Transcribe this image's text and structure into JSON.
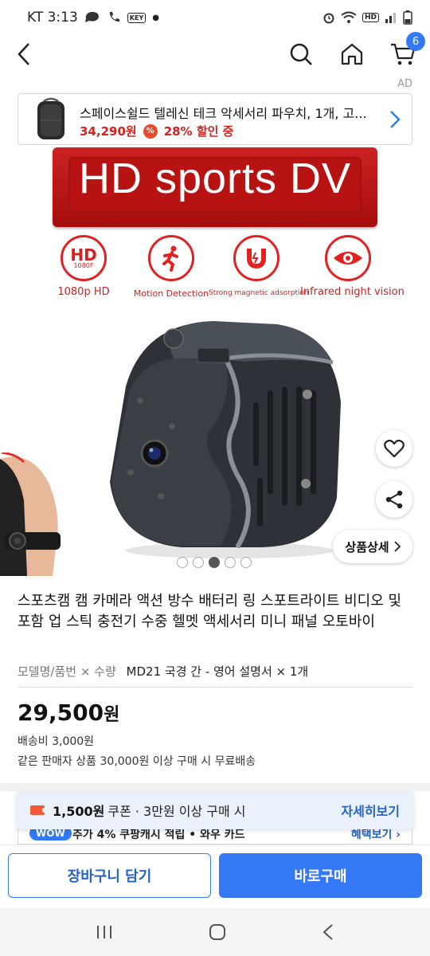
{
  "status_bar": {
    "carrier_time": "KT 3:13",
    "key_label": "KEY",
    "hd_label": "HD"
  },
  "header": {
    "cart_count": "6"
  },
  "ad": {
    "label": "AD",
    "title": "스페이스쉴드 텔레신 테크 악세서리 파우치, 1개, 고...",
    "price": "34,290원",
    "pct_symbol": "%",
    "discount": "28% 할인 중"
  },
  "product_image": {
    "banner_text": "HD sports DV",
    "features": [
      {
        "icon": "hd-1080f-icon",
        "badge_main": "HD",
        "badge_sub": "1080F",
        "caption": "1080p HD"
      },
      {
        "icon": "running-person-icon",
        "caption": "Motion Detection"
      },
      {
        "icon": "magnet-icon",
        "caption": "Strong magnetic adsorption"
      },
      {
        "icon": "eye-icon",
        "caption": "Infrared night vision"
      }
    ],
    "carousel_total": 5,
    "carousel_active": 3,
    "detail_label": "상품상세"
  },
  "product": {
    "title": "스포츠캠 캠 카메라 액션 방수 배터리 링 스포트라이트 비디오 및 포함 업 스틱 충전기 수중 헬멧 액세서리 미니 패널 오토바이",
    "option_label": "모델명/품번 × 수량",
    "option_value": "MD21 국경 간 - 영어 설명서 × 1개",
    "price_number": "29,500",
    "price_unit": "원",
    "shipping": "배송비 3,000원",
    "free_shipping": "같은 판매자 상품 30,000원 이상 구매 시 무료배송"
  },
  "coupon": {
    "amount": "1,500원",
    "desc": "쿠폰 · 3만원 이상 구매 시",
    "more": "자세히보기"
  },
  "wow_row": {
    "badge": "WOW",
    "text": "추가 4% 쿠팡캐시 적립 • 와우 카드",
    "link": "혜택보기 ›"
  },
  "actions": {
    "cart": "장바구니 담기",
    "buy": "바로구매"
  },
  "colors": {
    "accent": "#3478f6",
    "price_red": "#d6221d",
    "feature_red": "#e02222"
  }
}
